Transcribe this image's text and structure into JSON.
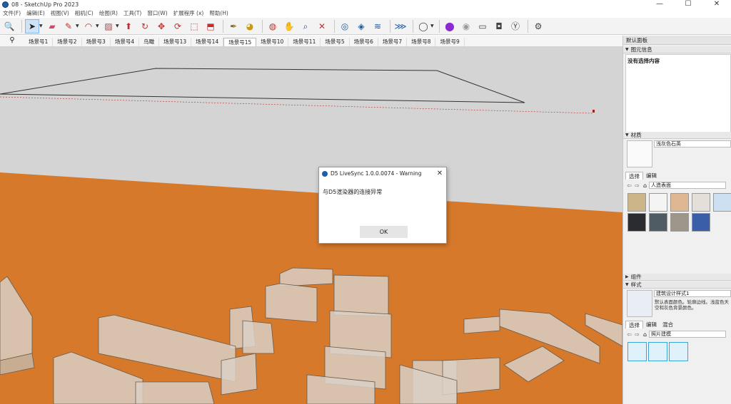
{
  "window": {
    "title": "08 - SketchUp Pro 2023",
    "controls": [
      "—",
      "☐",
      "✕"
    ]
  },
  "menu": [
    "文件(F)",
    "编辑(E)",
    "视图(V)",
    "相机(C)",
    "绘图(R)",
    "工具(T)",
    "窗口(W)",
    "扩展程序 (x)",
    "帮助(H)"
  ],
  "scenes": {
    "tabs": [
      "场景号1",
      "场景号2",
      "场景号3",
      "场景号4",
      "鸟瞰",
      "场景号13",
      "场景号14",
      "场景号15",
      "场景号10",
      "场景号11",
      "场景号5",
      "场景号6",
      "场景号7",
      "场景号8",
      "场景号9"
    ],
    "current_index": 7
  },
  "dialog": {
    "title": "D5 LiveSync 1.0.0.0074 - Warning",
    "message": "与D5渲染器的连接异常",
    "ok_label": "OK",
    "close_glyph": "✕"
  },
  "tray": {
    "title": "默认面板",
    "entity_info": {
      "header": "图元信息",
      "body": "没有选择内容"
    },
    "materials": {
      "header": "材质",
      "name": "浅灰色石英",
      "tab_select": "选择",
      "tab_edit": "编辑",
      "library": "人造表面",
      "swatches": [
        "#cdb58a",
        "#f4f4f4",
        "#ddb892",
        "#e4dfd8",
        "#cde0f2",
        "#2a2c30",
        "#4f5c63",
        "#9b9689",
        "#3b5ea8"
      ]
    },
    "components": {
      "header": "组件"
    },
    "styles": {
      "header": "样式",
      "name": "建筑设计样式1",
      "description": "默认表面颜色。轮廓边线。浅蓝色天空和灰色背景颜色。",
      "tab_select": "选择",
      "tab_edit": "编辑",
      "tab_mix": "混合",
      "library": "照片建模"
    }
  },
  "colors": {
    "ground": "#d6792a",
    "sky": "#d4d4d4",
    "accent": "#3aa6d8"
  }
}
